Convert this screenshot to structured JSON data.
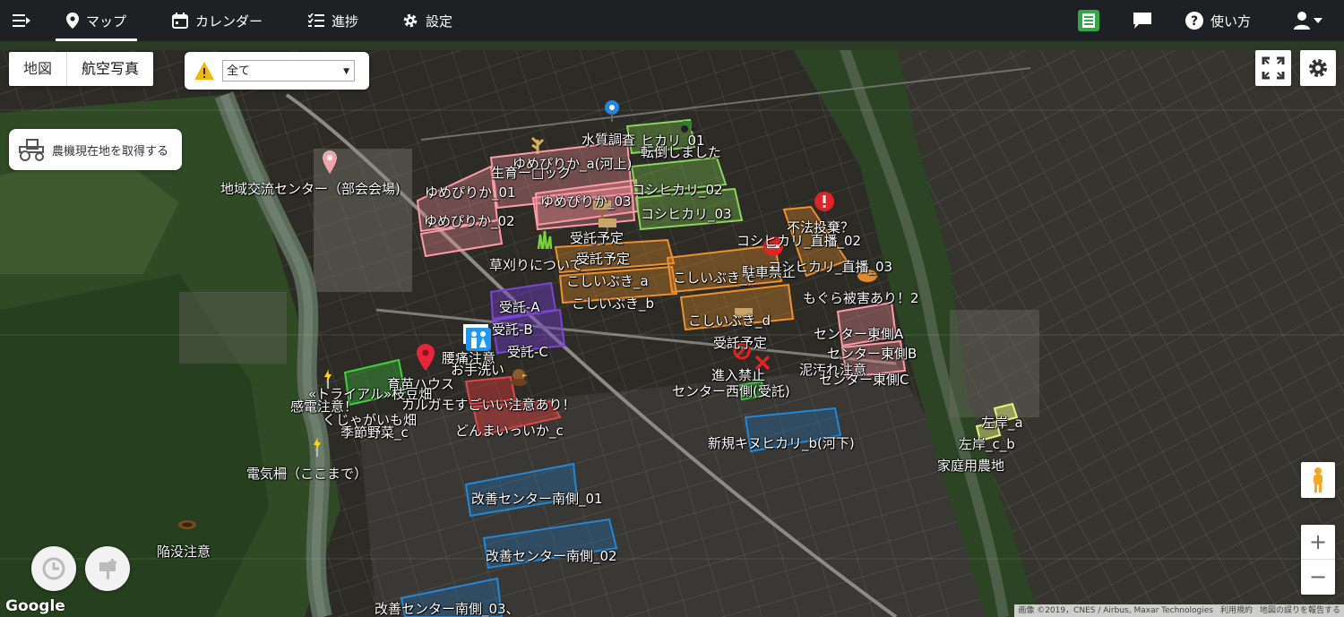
{
  "nav": {
    "items": [
      {
        "label": "マップ"
      },
      {
        "label": "カレンダー"
      },
      {
        "label": "進捗"
      },
      {
        "label": "設定"
      }
    ],
    "help": "使い方"
  },
  "map_controls": {
    "type_map": "地図",
    "type_aerial": "航空写真",
    "filter_value": "全て",
    "tractor_button": "農機現在地を取得する"
  },
  "labels": [
    {
      "text": "水質調査"
    },
    {
      "text": "ヒカリ_01"
    },
    {
      "text": "転倒しました"
    },
    {
      "text": "ゆめぴりか_a(河上)"
    },
    {
      "text": "生育ー□ック"
    },
    {
      "text": "地域交流センター（部会会場)"
    },
    {
      "text": "ゆめぴりか_01"
    },
    {
      "text": "コシヒカリ_02"
    },
    {
      "text": "ゆめぴりか_03"
    },
    {
      "text": "コシヒカリ_03"
    },
    {
      "text": "ゆめぴりか_02"
    },
    {
      "text": "不法投棄？"
    },
    {
      "text": "受託予定"
    },
    {
      "text": "コシヒカリ_直播_02"
    },
    {
      "text": "草刈りについて"
    },
    {
      "text": "受託予定"
    },
    {
      "text": "駐車禁止"
    },
    {
      "text": "コシヒカリ_直播_03"
    },
    {
      "text": "こしいぶき_a"
    },
    {
      "text": "こしいぶき_c"
    },
    {
      "text": "もぐら被害あり！2"
    },
    {
      "text": "こしいぶき_b"
    },
    {
      "text": "受託-A"
    },
    {
      "text": "こしいぶき_d"
    },
    {
      "text": "受託-B"
    },
    {
      "text": "センター東側A"
    },
    {
      "text": "腰痛注意"
    },
    {
      "text": "受託-C"
    },
    {
      "text": "受託予定"
    },
    {
      "text": "センター東側B"
    },
    {
      "text": "お手洗い"
    },
    {
      "text": "泥汚れ注意"
    },
    {
      "text": "進入禁止"
    },
    {
      "text": "センター東側C"
    },
    {
      "text": "育苗ハウス"
    },
    {
      "text": "センター西側(受託)"
    },
    {
      "text": "«トライアル»枝豆畑"
    },
    {
      "text": "カルガモすごいい注意あり！"
    },
    {
      "text": "感電注意！"
    },
    {
      "text": "どんまいっいか_c"
    },
    {
      "text": "くじゃがいも畑"
    },
    {
      "text": "季節野菜_c"
    },
    {
      "text": "新規キヌヒカリ_b(河下)"
    },
    {
      "text": "左岸_a"
    },
    {
      "text": "左岸_c_b"
    },
    {
      "text": "家庭用農地"
    },
    {
      "text": "電気柵（ここまで）"
    },
    {
      "text": "改善センター南側_01"
    },
    {
      "text": "改善センター南側_02"
    },
    {
      "text": "陥没注意"
    },
    {
      "text": "改善センター南側_03、"
    }
  ],
  "footer": {
    "google": "Google",
    "attribution": "画像 ©2019，CNES / Airbus, Maxar Technologies",
    "terms": "利用規約",
    "report": "地図の誤りを報告する"
  }
}
